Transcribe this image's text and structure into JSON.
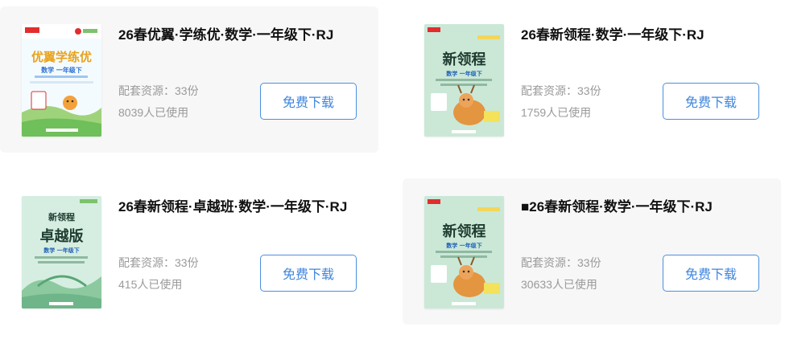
{
  "resources": [
    {
      "title": "26春优翼·学练优·数学·一年级下·RJ",
      "resource_label": "配套资源：",
      "resource_count": "33份",
      "usage_count": "8039",
      "usage_suffix": "人已使用",
      "button_label": "免费下载",
      "cover": {
        "brand": "优翼学练优",
        "subject": "数学 一年级下"
      }
    },
    {
      "title": "26春新领程·数学·一年级下·RJ",
      "resource_label": "配套资源：",
      "resource_count": "33份",
      "usage_count": "1759",
      "usage_suffix": "人已使用",
      "button_label": "免费下载",
      "cover": {
        "brand": "新领程",
        "subject": "数学 一年级下"
      }
    },
    {
      "title": "26春新领程·卓越班·数学·一年级下·RJ",
      "resource_label": "配套资源：",
      "resource_count": "33份",
      "usage_count": "415",
      "usage_suffix": "人已使用",
      "button_label": "免费下载",
      "cover": {
        "brand": "新领程",
        "brand2": "卓越版",
        "subject": "数学 一年级下"
      }
    },
    {
      "title": "■26春新领程·数学·一年级下·RJ",
      "resource_label": "配套资源：",
      "resource_count": "33份",
      "usage_count": "30633",
      "usage_suffix": "人已使用",
      "button_label": "免费下载",
      "cover": {
        "brand": "新领程",
        "subject": "数学 一年级下"
      }
    }
  ],
  "colors": {
    "button_text": "#3f86dd",
    "button_border": "#4a8fe0",
    "card_highlight": "#f7f7f7",
    "meta_text": "#9a9a9a"
  }
}
